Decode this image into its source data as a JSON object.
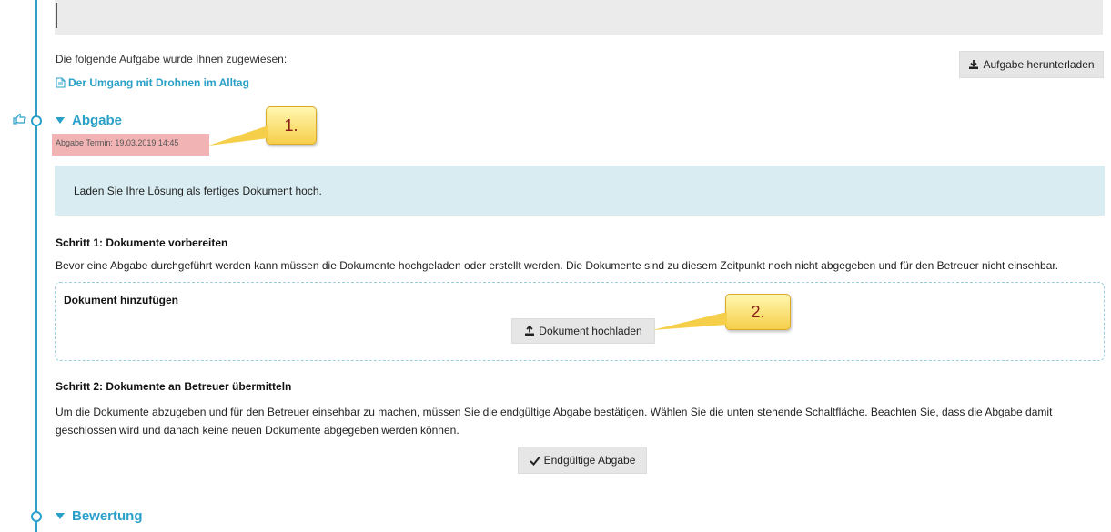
{
  "assignment": {
    "intro_text": "Die folgende Aufgabe wurde Ihnen zugewiesen:",
    "task_link": "Der Umgang mit Drohnen im Alltag",
    "download_button": "Aufgabe herunterladen"
  },
  "abgabe": {
    "title": "Abgabe",
    "deadline": "Abgabe Termin: 19.03.2019 14:45",
    "info": "Laden Sie Ihre Lösung als fertiges Dokument hoch.",
    "step1_title": "Schritt 1: Dokumente vorbereiten",
    "step1_text": "Bevor eine Abgabe durchgeführt werden kann müssen die Dokumente hochgeladen oder erstellt werden. Die Dokumente sind zu diesem Zeitpunkt noch nicht abgegeben und für den Betreuer nicht einsehbar.",
    "add_document_title": "Dokument hinzufügen",
    "upload_button": "Dokument hochladen",
    "step2_title": "Schritt 2: Dokumente an Betreuer übermitteln",
    "step2_text": "Um die Dokumente abzugeben und für den Betreuer einsehbar zu machen, müssen Sie die endgültige Abgabe bestätigen. Wählen Sie die unten stehende Schaltfläche. Beachten Sie, dass die Abgabe damit geschlossen wird und danach keine neuen Dokumente abgegeben werden können.",
    "final_button": "Endgültige Abgabe"
  },
  "bewertung": {
    "title": "Bewertung"
  },
  "callouts": {
    "first": "1.",
    "second": "2."
  },
  "colors": {
    "accent": "#2aa0c8",
    "info_bg": "#d9ecf2",
    "highlight": "#f1b3b3"
  }
}
